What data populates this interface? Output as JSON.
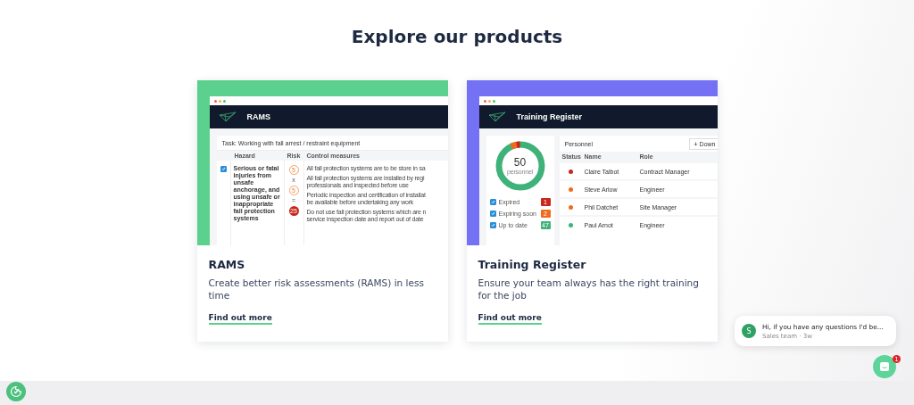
{
  "heading": "Explore our products",
  "products": [
    {
      "kind": "rams",
      "color": "#5cd18e",
      "name": "RAMS",
      "description": "Create better risk assessments (RAMS) in less time",
      "link": "Find out more",
      "preview": {
        "app_title": "RAMS",
        "task_label": "Task:",
        "task": "Working with fall arrest / restraint equipment",
        "columns": [
          "Hazard",
          "Risk",
          "Control measures"
        ],
        "row": {
          "checked": true,
          "hazard": "Serious or fatal injuries from unsafe anchorage, and using unsafe or inappropriate fall protection systems",
          "risk": [
            {
              "kind": "score",
              "text": "5"
            },
            {
              "kind": "operator",
              "text": "x"
            },
            {
              "kind": "score",
              "text": "5"
            },
            {
              "kind": "operator",
              "text": "="
            },
            {
              "kind": "total",
              "text": "25"
            }
          ],
          "controls": [
            {
              "lines": [
                "All fall protection systems are to be store in sa"
              ]
            },
            {
              "lines": [
                "All fall protection systems are installed by regi",
                "professionals and inspected before use"
              ]
            },
            {
              "lines": [
                "Periodic inspection and certification of installat",
                "be available before undertaking any work"
              ]
            },
            {
              "lines": [
                "Do not use fall protection systems which are n",
                "service inspection date and report out of date"
              ]
            }
          ]
        }
      }
    },
    {
      "kind": "training",
      "color": "#7471f5",
      "name": "Training Register",
      "description": "Ensure your team always has the right training for the job",
      "link": "Find out more",
      "preview": {
        "app_title": "Training Register",
        "total": "50",
        "total_label": "personnel",
        "legend": [
          {
            "label": "Expired",
            "count": "1",
            "checked": true,
            "color": "#c8281c"
          },
          {
            "label": "Expiring soon",
            "count": "2",
            "checked": true,
            "color": "#f06a1e"
          },
          {
            "label": "Up to date",
            "count": "47",
            "checked": true,
            "color": "#3fb27a"
          }
        ],
        "table_title": "Personnel",
        "download": "Down",
        "columns": [
          "Status",
          "Name",
          "Role"
        ],
        "rows": [
          {
            "name": "Claire Talbot",
            "role": "Contract Manager",
            "color": "#c8281c"
          },
          {
            "name": "Steve Arlow",
            "role": "Engineer",
            "color": "#f06a1e"
          },
          {
            "name": "Phil Datchet",
            "role": "Site Manager",
            "color": "#f06a1e"
          },
          {
            "name": "Paul Arnot",
            "role": "Engineer",
            "color": "#3fb27a"
          }
        ]
      }
    }
  ],
  "chat": {
    "avatar": "S",
    "message": "Hi, if you have any questions I'd be...",
    "meta": "Sales team · 3w",
    "badge": "1"
  }
}
